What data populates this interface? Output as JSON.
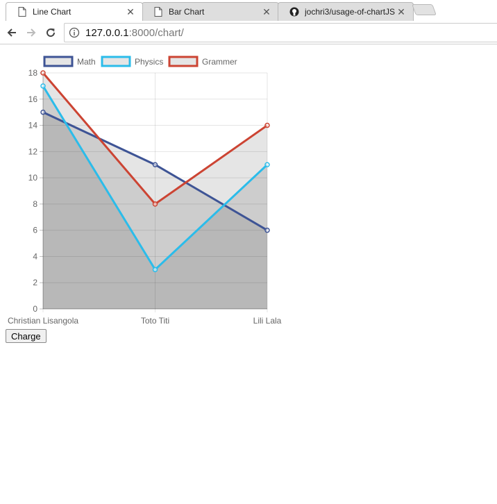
{
  "browser": {
    "tabs": [
      {
        "title": "Line Chart",
        "icon": "page-icon",
        "active": true
      },
      {
        "title": "Bar Chart",
        "icon": "page-icon",
        "active": false
      },
      {
        "title": "jochri3/usage-of-chartJS",
        "icon": "github-icon",
        "active": false
      }
    ],
    "url_host": "127.0.0.1",
    "url_rest": ":8000/chart/"
  },
  "chart_data": {
    "type": "line",
    "categories": [
      "Christian Lisangola",
      "Toto Titi",
      "Lili Lala"
    ],
    "series": [
      {
        "name": "Math",
        "values": [
          15,
          11,
          6
        ],
        "color": "#3e5495"
      },
      {
        "name": "Physics",
        "values": [
          17,
          3,
          11
        ],
        "color": "#2bbcea"
      },
      {
        "name": "Grammer",
        "values": [
          18,
          8,
          14
        ],
        "color": "#cc4433"
      }
    ],
    "ylim": [
      0,
      18
    ],
    "y_ticks": [
      "0",
      "2",
      "4",
      "6",
      "8",
      "10",
      "12",
      "14",
      "16",
      "18"
    ],
    "grid": true,
    "legend": "top",
    "area_fill": true
  },
  "charge_label": "Charge"
}
